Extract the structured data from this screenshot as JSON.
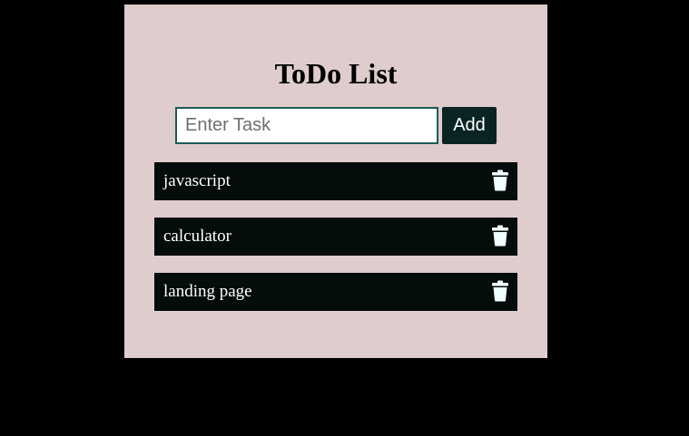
{
  "app": {
    "title": "ToDo List"
  },
  "input": {
    "placeholder": "Enter Task",
    "value": ""
  },
  "add_button": {
    "label": "Add"
  },
  "tasks": [
    {
      "label": "javascript",
      "action_icon": "trash-icon"
    },
    {
      "label": "calculator",
      "action_icon": "trash-icon"
    },
    {
      "label": "landing page",
      "action_icon": "trash-icon"
    }
  ],
  "colors": {
    "page_background": "#000000",
    "card_background": "#dfcccc",
    "task_background": "#040c0c",
    "button_background": "#0a2424",
    "input_border": "#1d5a5a",
    "icon_color": "#f0ffff"
  }
}
